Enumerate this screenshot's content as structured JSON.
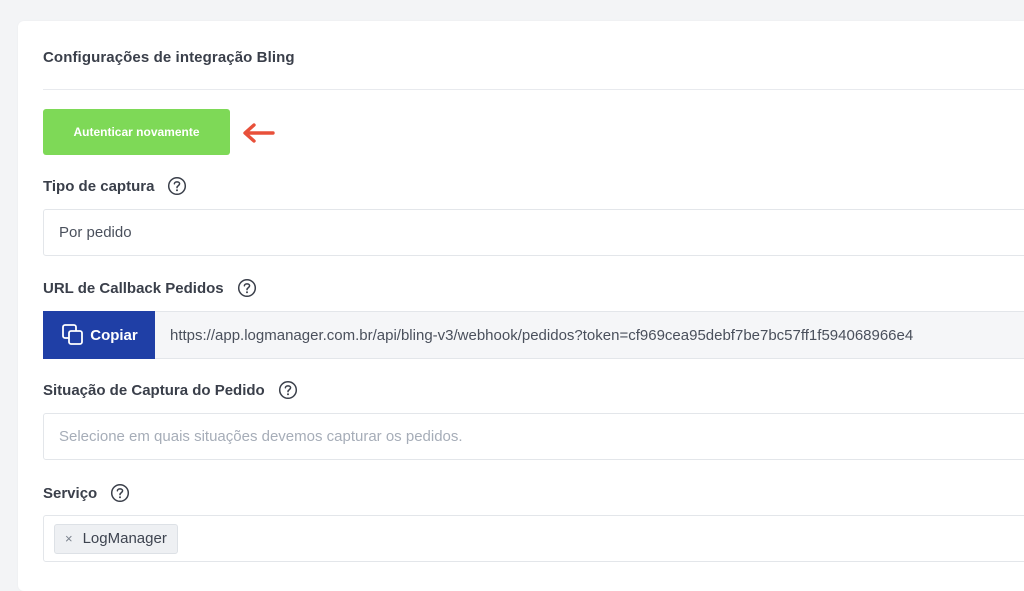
{
  "card": {
    "title": "Configurações de integração Bling"
  },
  "auth": {
    "button_label": "Autenticar novamente"
  },
  "colors": {
    "auth_button": "#7ed957",
    "copy_button": "#1f3fa6",
    "arrow": "#e8503a"
  },
  "fields": {
    "capture_type": {
      "label": "Tipo de captura",
      "value": "Por pedido"
    },
    "callback_url": {
      "label": "URL de Callback Pedidos",
      "copy_label": "Copiar",
      "value": "https://app.logmanager.com.br/api/bling-v3/webhook/pedidos?token=cf969cea95debf7be7bc57ff1f594068966e4"
    },
    "capture_status": {
      "label": "Situação de Captura do Pedido",
      "placeholder": "Selecione em quais situações devemos capturar os pedidos."
    },
    "service": {
      "label": "Serviço",
      "tags": [
        {
          "remove": "×",
          "label": "LogManager"
        }
      ]
    }
  },
  "icons": {
    "help": "help-circle-icon",
    "copy": "copy-icon",
    "arrow": "arrow-left-icon"
  }
}
